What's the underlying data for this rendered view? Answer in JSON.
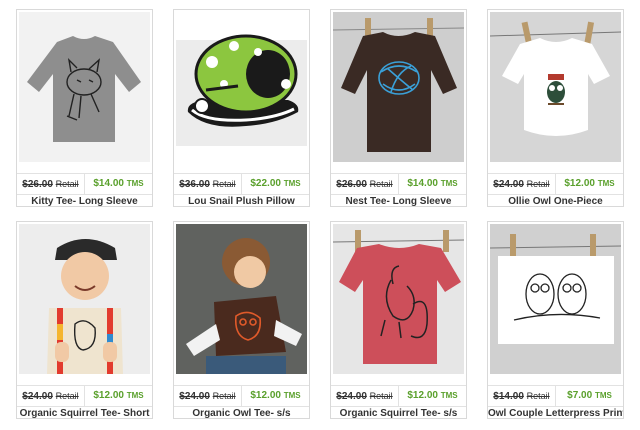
{
  "products": [
    {
      "name": "Kitty Tee- Long Sleeve",
      "retail": "$26.00",
      "retail_label": "Retail",
      "price": "$14.00",
      "price_label": "TMS"
    },
    {
      "name": "Lou Snail Plush Pillow",
      "retail": "$36.00",
      "retail_label": "Retail",
      "price": "$22.00",
      "price_label": "TMS"
    },
    {
      "name": "Nest Tee- Long Sleeve",
      "retail": "$26.00",
      "retail_label": "Retail",
      "price": "$14.00",
      "price_label": "TMS"
    },
    {
      "name": "Ollie Owl One-Piece",
      "retail": "$24.00",
      "retail_label": "Retail",
      "price": "$12.00",
      "price_label": "TMS"
    },
    {
      "name": "Organic Squirrel Tee- Short",
      "retail": "$24.00",
      "retail_label": "Retail",
      "price": "$12.00",
      "price_label": "TMS"
    },
    {
      "name": "Organic Owl Tee- s/s",
      "retail": "$24.00",
      "retail_label": "Retail",
      "price": "$12.00",
      "price_label": "TMS"
    },
    {
      "name": "Organic Squirrel Tee- s/s",
      "retail": "$24.00",
      "retail_label": "Retail",
      "price": "$12.00",
      "price_label": "TMS"
    },
    {
      "name": "Owl Couple Letterpress Print",
      "retail": "$14.00",
      "retail_label": "Retail",
      "price": "$7.00",
      "price_label": "TMS"
    }
  ],
  "colors": {
    "price_green": "#5aa02c",
    "border": "#d9d9d9"
  }
}
